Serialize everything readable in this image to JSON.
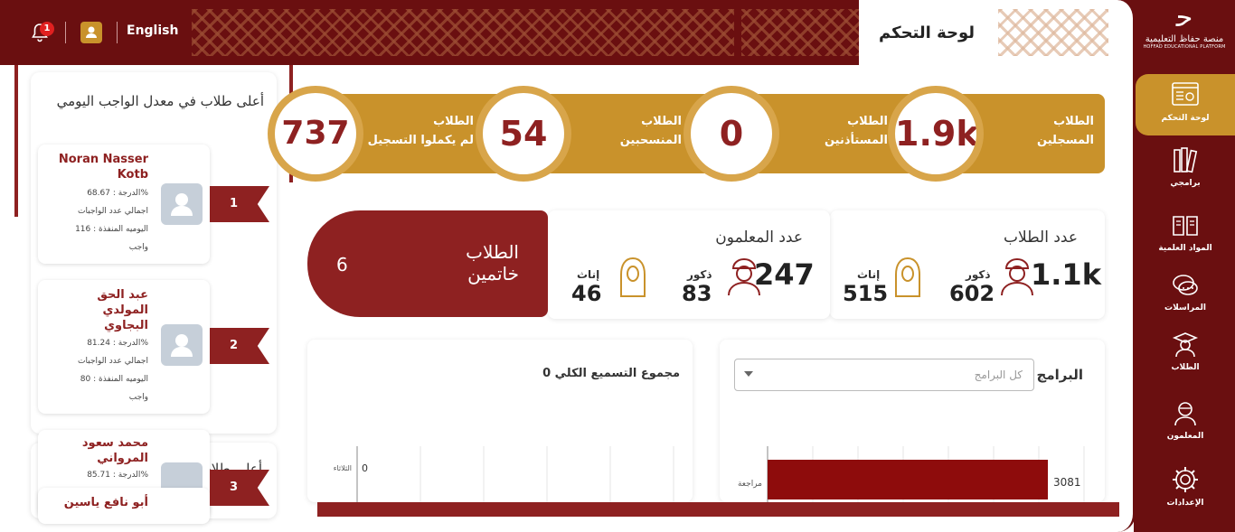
{
  "header": {
    "page_title": "لوحة التحكم",
    "language": "English",
    "notification_count": "1"
  },
  "brand": {
    "name": "منصة حفاظ التعليمية",
    "subtitle": "HOFFAD EDUCATIONAL PLATFORM"
  },
  "sidebar": {
    "items": [
      {
        "label": "لوحة التحكم",
        "icon": "dashboard-icon"
      },
      {
        "label": "برامجي",
        "icon": "books-icon"
      },
      {
        "label": "المواد العلمية",
        "icon": "book-open-icon"
      },
      {
        "label": "المراسلات",
        "icon": "chat-icon"
      },
      {
        "label": "الطلاب",
        "icon": "graduate-icon"
      },
      {
        "label": "المعلمون",
        "icon": "teacher-icon"
      },
      {
        "label": "الإعدادات",
        "icon": "gear-icon"
      }
    ]
  },
  "stats": [
    {
      "value": "1.9k",
      "label_line1": "الطلاب",
      "label_line2": "المسجلين"
    },
    {
      "value": "0",
      "label_line1": "الطلاب",
      "label_line2": "المستأذنين"
    },
    {
      "value": "54",
      "label_line1": "الطلاب",
      "label_line2": "المنسحبين"
    },
    {
      "value": "737",
      "label_line1": "الطلاب",
      "label_line2": "لم يكملوا التسجيل"
    }
  ],
  "students_count": {
    "title": "عدد الطلاب",
    "total": "1.1k",
    "males_label": "ذكور",
    "males": "602",
    "females_label": "إناث",
    "females": "515"
  },
  "teachers_count": {
    "title": "عدد المعلمون",
    "total": "247",
    "males_label": "ذكور",
    "males": "83",
    "females_label": "إناث",
    "females": "46"
  },
  "graduated": {
    "label_line1": "الطلاب",
    "label_line2": "خاتمين",
    "value": "6"
  },
  "programs_chart": {
    "title": "البرامج",
    "select_placeholder": "كل البرامج"
  },
  "recitation_chart": {
    "title": "مجموع التسميع الكلي 0"
  },
  "chart_data": [
    {
      "type": "bar",
      "orientation": "horizontal",
      "categories": [
        "مراجعة"
      ],
      "values": [
        3081
      ],
      "value_labels": [
        "3081"
      ]
    },
    {
      "type": "bar",
      "orientation": "horizontal",
      "categories": [
        "الثلاثاء"
      ],
      "values": [
        0
      ],
      "value_labels": [
        "0"
      ]
    }
  ],
  "left_panel": {
    "title": "أعلى طلاب في معدل الواجب اليومي",
    "second_title": "أعلى طلاب في التقييم",
    "students": [
      {
        "rank": "1",
        "name_line1": "Noran Nasser",
        "name_line2": "Kotb",
        "name_line3": "",
        "score": "الدرجة : 68.67%",
        "line2": "اجمالي عدد الواجبات",
        "line3": "اليوميه المنفذة : 116",
        "line4": "واجب"
      },
      {
        "rank": "2",
        "name_line1": "عبد الحق",
        "name_line2": "المولدي",
        "name_line3": "البجاوي",
        "score": "الدرجة : 81.24%",
        "line2": "اجمالي عدد الواجبات",
        "line3": "اليوميه المنفذة : 80",
        "line4": "واجب"
      },
      {
        "rank": "3",
        "name_line1": "محمد سعود",
        "name_line2": "المرواني",
        "name_line3": "",
        "score": "الدرجة : 85.71%",
        "line2": "",
        "line3": "",
        "line4": ""
      }
    ],
    "partial_student": "أبو نافع ياسين"
  }
}
